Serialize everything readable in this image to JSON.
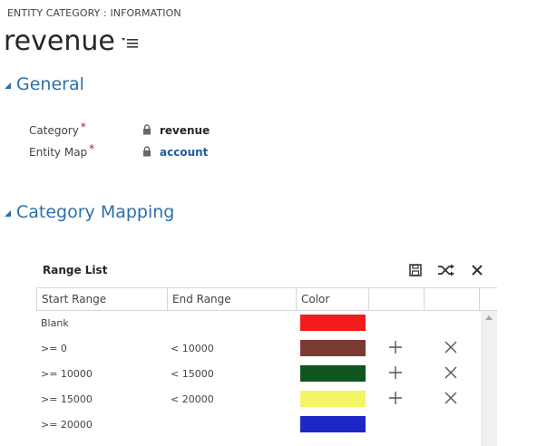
{
  "header": {
    "entity_label": "ENTITY CATEGORY : INFORMATION",
    "record_title": "revenue"
  },
  "sections": {
    "general": {
      "title": "General"
    },
    "mapping": {
      "title": "Category Mapping"
    }
  },
  "fields": {
    "category": {
      "label": "Category",
      "required": "*",
      "value": "revenue"
    },
    "entity_map": {
      "label": "Entity Map",
      "required": "*",
      "value": "account"
    }
  },
  "grid": {
    "title": "Range List",
    "columns": {
      "start": "Start Range",
      "end": "End Range",
      "color": "Color"
    },
    "rows": [
      {
        "start": "Blank",
        "end": "",
        "color": "#f31b1b",
        "actions": false
      },
      {
        "start": ">= 0",
        "end": "< 10000",
        "color": "#7b3a33",
        "actions": true
      },
      {
        "start": ">= 10000",
        "end": "< 15000",
        "color": "#0e561e",
        "actions": true
      },
      {
        "start": ">= 15000",
        "end": "< 20000",
        "color": "#f4f467",
        "actions": true
      },
      {
        "start": ">= 20000",
        "end": "",
        "color": "#1c27c6",
        "actions": false
      }
    ]
  },
  "icons": {
    "record_menu": "list-menu-icon",
    "lock": "lock-icon",
    "save": "save-icon",
    "shuffle": "shuffle-icon",
    "close": "close-icon",
    "add": "plus-icon",
    "delete": "x-icon"
  },
  "colors": {
    "accent": "#2e6fa8",
    "link": "#1f5d9e",
    "required": "#c8102e"
  }
}
